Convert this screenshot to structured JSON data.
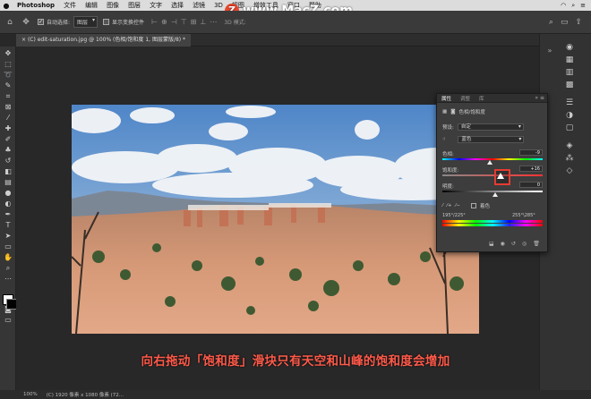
{
  "menubar": {
    "apple": "",
    "app": "Photoshop",
    "items": [
      "文件",
      "编辑",
      "图像",
      "图层",
      "文字",
      "选择",
      "滤镜",
      "3D",
      "视图",
      "增效工具",
      "窗口",
      "帮助"
    ]
  },
  "watermark": {
    "logo": "Z",
    "text": "www.MacZ.com"
  },
  "options": {
    "auto_select_label": "自动选择:",
    "auto_select_value": "图层",
    "show_transform_label": "显示变换控件",
    "three_d_label": "3D 模式:"
  },
  "tab": {
    "title": "(C) edit-saturation.jpg @ 100% (色相/饱和度 1, 图层蒙版/8) *"
  },
  "panel": {
    "tabs": [
      "属性",
      "调整",
      "库"
    ],
    "title": "色相/饱和度",
    "preset_label": "预设:",
    "preset_value": "自定",
    "range_value": "蓝色",
    "hue_label": "色相:",
    "hue_value": "-9",
    "sat_label": "饱和度:",
    "sat_value": "+16",
    "light_label": "明度:",
    "light_value": "0",
    "colorize_label": "着色",
    "range_left": "195°/225°",
    "range_right": "255°\\285°"
  },
  "caption": "向右拖动「饱和度」滑块只有天空和山峰的饱和度会增加",
  "status": {
    "zoom": "100%",
    "info": "(C) 1920 像素 x 1080 像素 (72..."
  },
  "chart_data": null
}
